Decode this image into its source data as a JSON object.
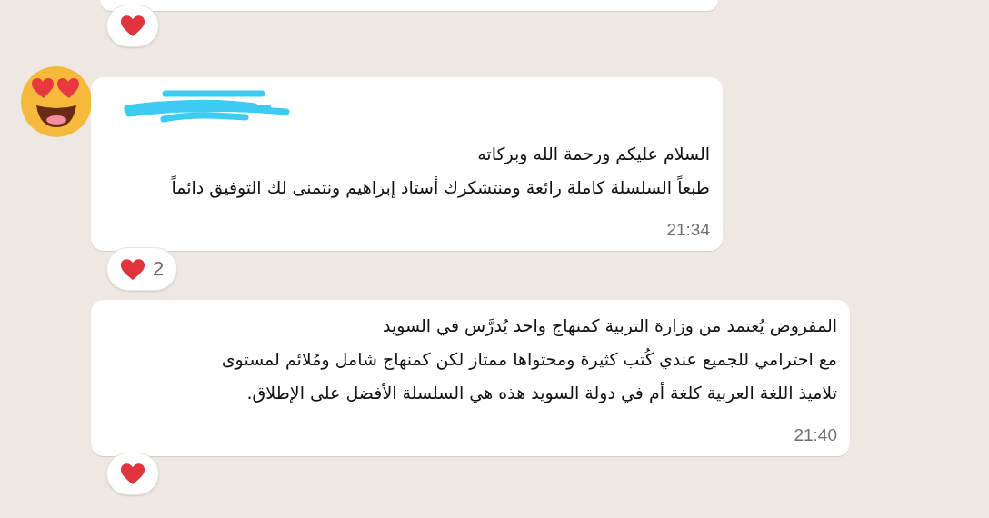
{
  "messages": [
    {
      "kind": "clipped",
      "reaction": {
        "kind": "heart"
      }
    },
    {
      "kind": "full",
      "show_avatar": true,
      "lines": [
        "السلام عليكم ورحمة الله وبركاته",
        "طبعاً السلسلة كاملة رائعة ومنتشكرك أستاذ إبراهيم ونتمنى لك التوفيق دائماً"
      ],
      "time": "21:34",
      "reaction": {
        "kind": "heart",
        "count": "2"
      }
    },
    {
      "kind": "full",
      "show_avatar": false,
      "lines": [
        "المفروض يُعتمد من وزارة التربية كمنهاج واحد يُدرَّس في السويد",
        "مع احترامي للجميع عندي كُتب كثيرة ومحتواها ممتاز لكن كمنهاج شامل ومُلائم لمستوى",
        "تلاميذ اللغة العربية كلغة أم في دولة السويد هذه هي السلسلة الأفضل على الإطلاق."
      ],
      "time": "21:40",
      "reaction": {
        "kind": "heart"
      }
    }
  ]
}
